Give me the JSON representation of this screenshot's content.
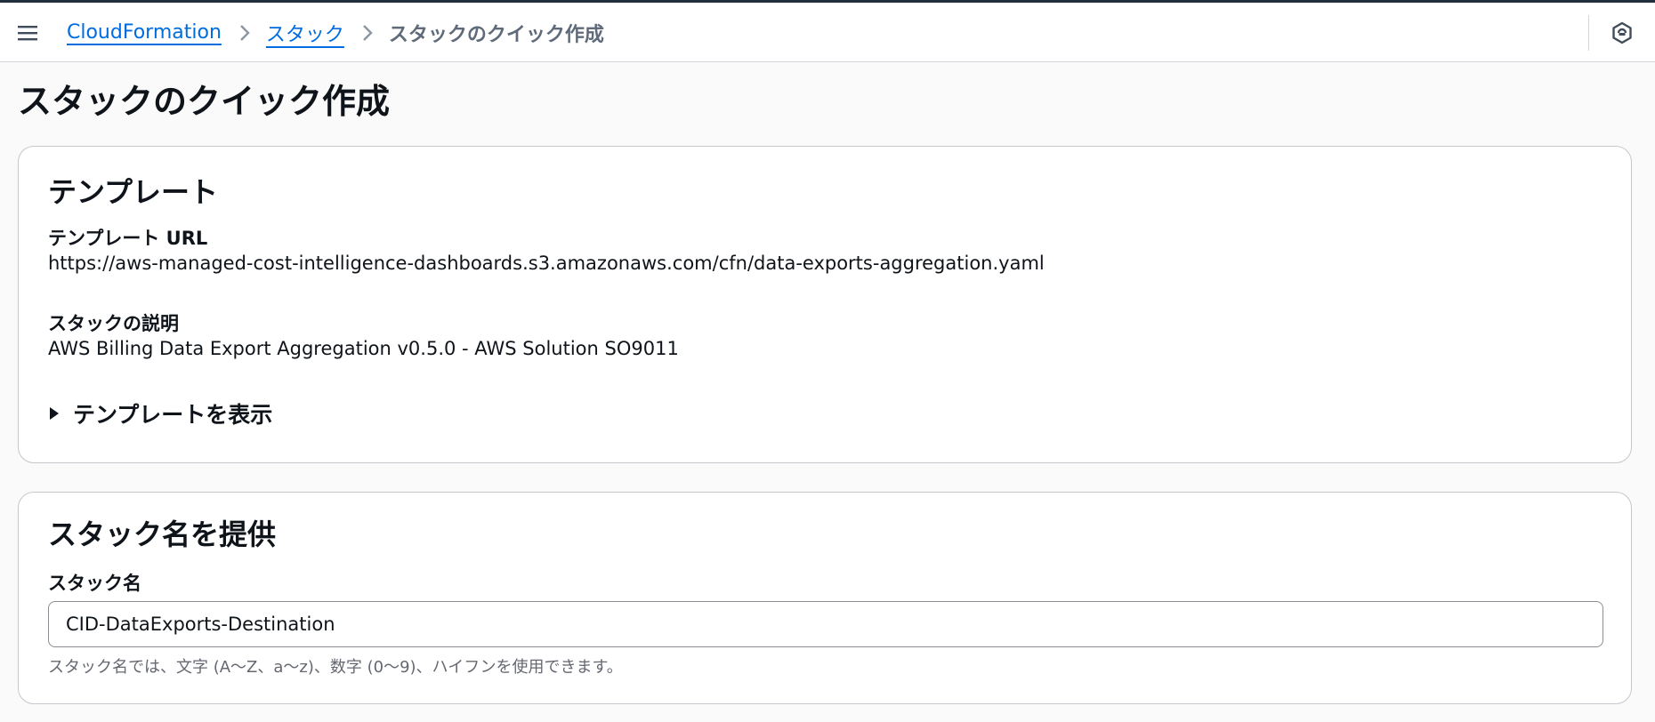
{
  "breadcrumb": {
    "items": [
      "CloudFormation",
      "スタック"
    ],
    "current": "スタックのクイック作成"
  },
  "page": {
    "title": "スタックのクイック作成"
  },
  "template_section": {
    "header": "テンプレート",
    "url_label": "テンプレート URL",
    "url_value": "https://aws-managed-cost-intelligence-dashboards.s3.amazonaws.com/cfn/data-exports-aggregation.yaml",
    "desc_label": "スタックの説明",
    "desc_value": "AWS Billing Data Export Aggregation v0.5.0 - AWS Solution SO9011",
    "expand_label": "テンプレートを表示"
  },
  "stack_name_section": {
    "header": "スタック名を提供",
    "field_label": "スタック名",
    "field_value": "CID-DataExports-Destination",
    "hint": "スタック名では、文字 (A〜Z、a〜z)、数字 (0〜9)、ハイフンを使用できます。"
  },
  "icons": {
    "menu": "hamburger-menu-icon",
    "separator": "chevron-right-icon",
    "help": "info-hexagon-icon",
    "expand": "caret-right-icon"
  },
  "colors": {
    "link": "#006ce0",
    "text": "#0f141a",
    "muted": "#5f6b7a",
    "border": "#c6c6cd"
  }
}
